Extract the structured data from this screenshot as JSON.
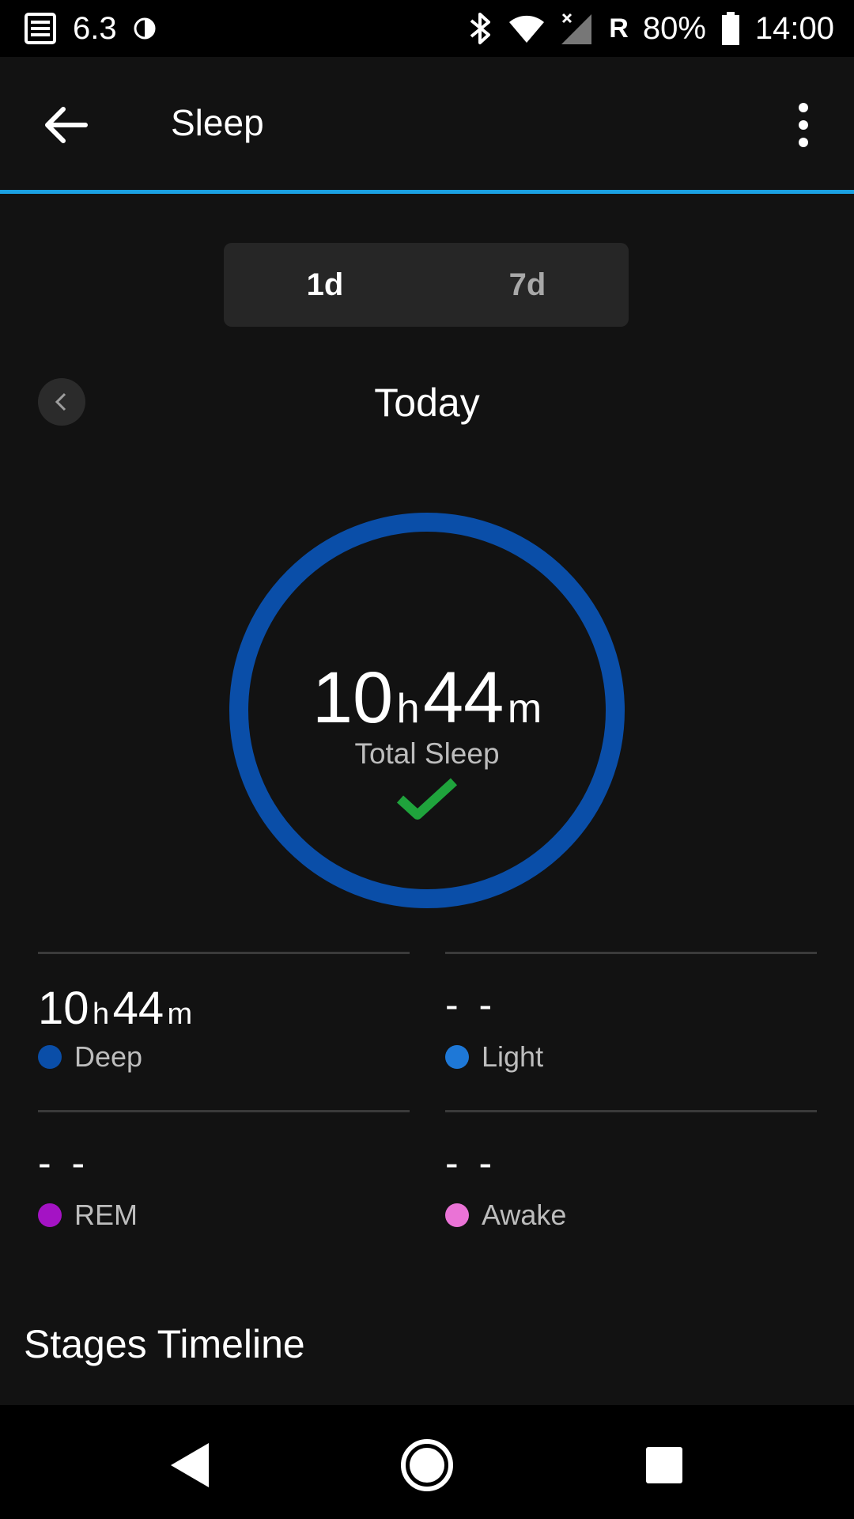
{
  "status_bar": {
    "notification_count": "6.3",
    "network_label": "R",
    "battery": "80%",
    "time": "14:00",
    "icons": [
      "news-icon",
      "contrast-icon",
      "bluetooth-icon",
      "wifi-icon",
      "signal-icon",
      "battery-icon"
    ]
  },
  "app_bar": {
    "title": "Sleep",
    "icons": [
      "back-arrow-icon",
      "more-vertical-icon"
    ]
  },
  "range_toggle": {
    "options": [
      "1d",
      "7d"
    ],
    "selected": "1d"
  },
  "date_nav": {
    "label": "Today"
  },
  "total_sleep": {
    "hours": "10",
    "hours_unit": "h",
    "minutes": "44",
    "minutes_unit": "m",
    "label": "Total Sleep",
    "goal_met_icon": "check-icon"
  },
  "stages": [
    {
      "label": "Deep",
      "hours": "10",
      "hours_unit": "h",
      "minutes": "44",
      "minutes_unit": "m",
      "color": "#0a4ea8"
    },
    {
      "label": "Light",
      "value": "- -",
      "color": "#1e78d7"
    },
    {
      "label": "REM",
      "value": "- -",
      "color": "#a413c4"
    },
    {
      "label": "Awake",
      "value": "- -",
      "color": "#ea73d6"
    }
  ],
  "section": {
    "title": "Stages Timeline"
  },
  "colors": {
    "accent": "#1ba1e2",
    "ring": "#0a4ea8",
    "check": "#1fa33c",
    "background": "#121212"
  },
  "nav_bar": {
    "icons": [
      "back-triangle-icon",
      "home-circle-icon",
      "recents-square-icon"
    ]
  }
}
